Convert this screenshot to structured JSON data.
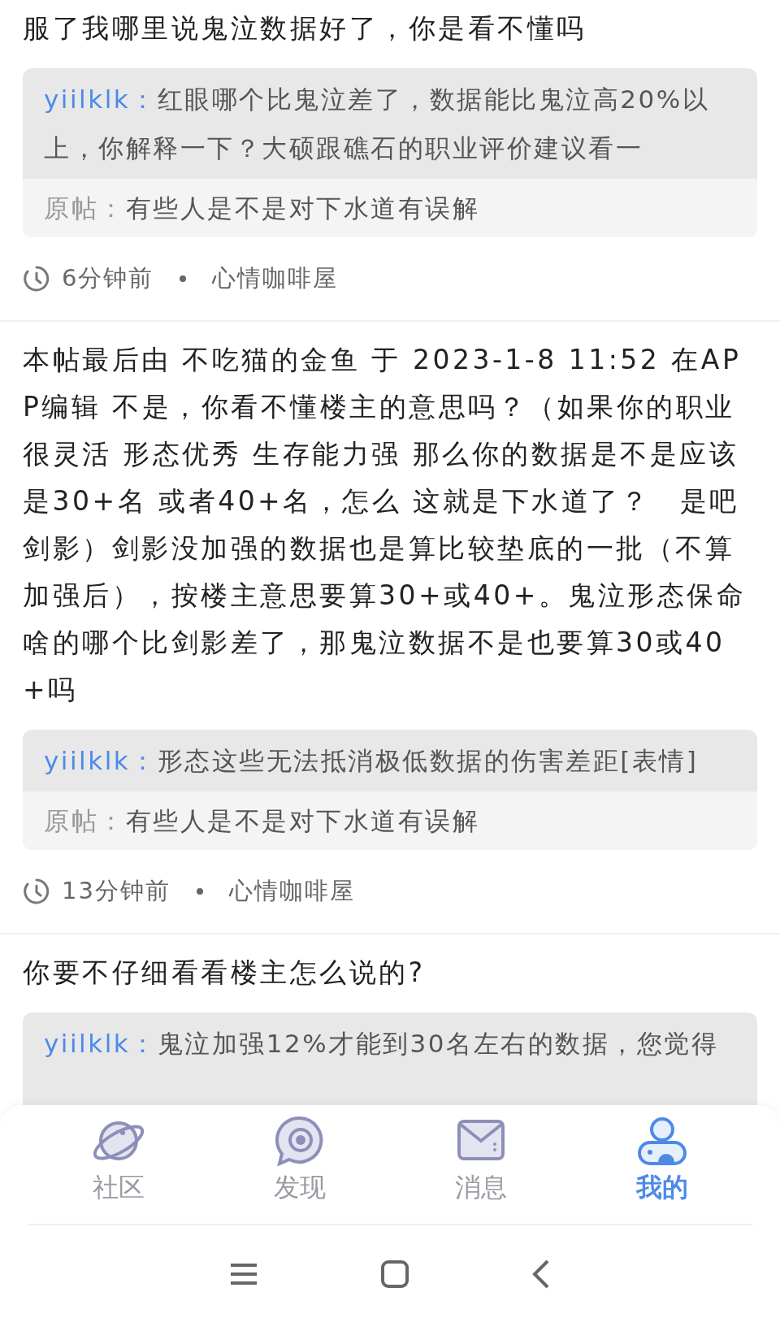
{
  "posts": [
    {
      "text": "服了我哪里说鬼泣数据好了，你是看不懂吗",
      "quote": {
        "author": "yiilklk：",
        "text": "红眼哪个比鬼泣差了，数据能比鬼泣高20%以上，你解释一下？大硕跟礁石的职业评价建议看一"
      },
      "original": {
        "label": "原帖：",
        "text": "有些人是不是对下水道有误解"
      },
      "time": "6分钟前",
      "forum": "心情咖啡屋"
    },
    {
      "text": "本帖最后由 不吃猫的金鱼 于 2023-1-8 11:52 在APP编辑 不是，你看不懂楼主的意思吗？（如果你的职业很灵活 形态优秀 生存能力强 那么你的数据是不是应该是30+名 或者40+名，怎么 这就是下水道了？　是吧剑影）剑影没加强的数据也是算比较垫底的一批（不算加强后），按楼主意思要算30+或40+。鬼泣形态保命啥的哪个比剑影差了，那鬼泣数据不是也要算30或40+吗",
      "quote": {
        "author": "yiilklk：",
        "text": "形态这些无法抵消极低数据的伤害差距[表情]"
      },
      "original": {
        "label": "原帖：",
        "text": "有些人是不是对下水道有误解"
      },
      "time": "13分钟前",
      "forum": "心情咖啡屋"
    },
    {
      "text": "你要不仔细看看楼主怎么说的?",
      "quote": {
        "author": "yiilklk：",
        "text": "鬼泣加强12%才能到30名左右的数据，您觉得"
      }
    }
  ],
  "tabs": [
    {
      "kind": "planet",
      "label": "社区",
      "selected": false
    },
    {
      "kind": "bubble",
      "label": "发现",
      "selected": false
    },
    {
      "kind": "mail",
      "label": "消息",
      "selected": false
    },
    {
      "kind": "person",
      "label": "我的",
      "selected": true
    }
  ]
}
